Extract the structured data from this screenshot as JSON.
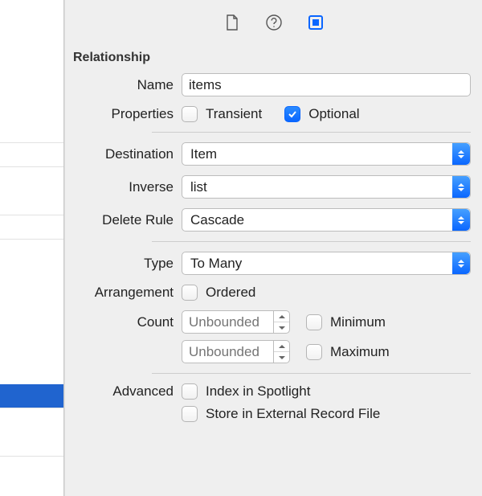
{
  "section": {
    "title": "Relationship"
  },
  "labels": {
    "name": "Name",
    "properties": "Properties",
    "destination": "Destination",
    "inverse": "Inverse",
    "deleteRule": "Delete Rule",
    "type": "Type",
    "arrangement": "Arrangement",
    "count": "Count",
    "advanced": "Advanced"
  },
  "values": {
    "name": "items",
    "destination": "Item",
    "inverse": "list",
    "deleteRule": "Cascade",
    "type": "To Many",
    "countMinPlaceholder": "Unbounded",
    "countMaxPlaceholder": "Unbounded"
  },
  "checks": {
    "transient": {
      "label": "Transient",
      "checked": false
    },
    "optional": {
      "label": "Optional",
      "checked": true
    },
    "ordered": {
      "label": "Ordered",
      "checked": false
    },
    "minimum": {
      "label": "Minimum",
      "checked": false
    },
    "maximum": {
      "label": "Maximum",
      "checked": false
    },
    "spotlight": {
      "label": "Index in Spotlight",
      "checked": false
    },
    "external": {
      "label": "Store in External Record File",
      "checked": false
    }
  }
}
